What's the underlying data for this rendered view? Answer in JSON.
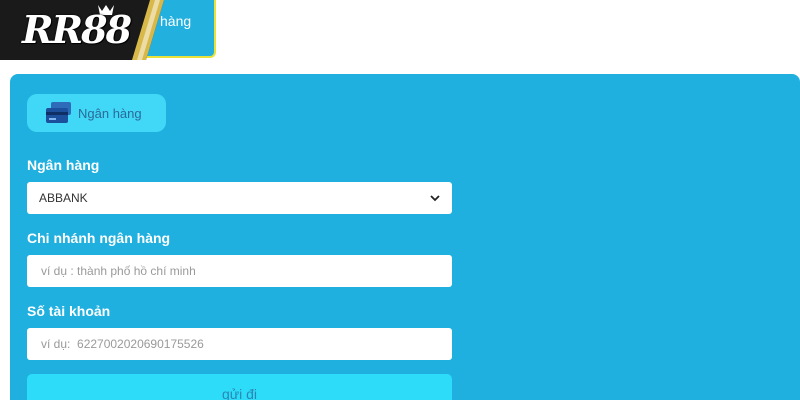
{
  "brand": {
    "logo_text": "RR88"
  },
  "top_tab": {
    "label": "hàng"
  },
  "method": {
    "label": "Ngân hàng",
    "icon": "bank-card-icon"
  },
  "form": {
    "bank": {
      "label": "Ngân hàng",
      "selected": "ABBANK"
    },
    "branch": {
      "label": "Chi nhánh ngân hàng",
      "placeholder": "ví dụ : thành phố hồ chí minh"
    },
    "account": {
      "label": "Số tài khoản",
      "placeholder": "ví dụ:  6227002020690175526"
    },
    "submit_label": "gửi đi"
  },
  "colors": {
    "panel": "#1fb0df",
    "chip": "#41d8f7",
    "submit": "#2cdcf9",
    "tab_border": "#e8e23a"
  }
}
